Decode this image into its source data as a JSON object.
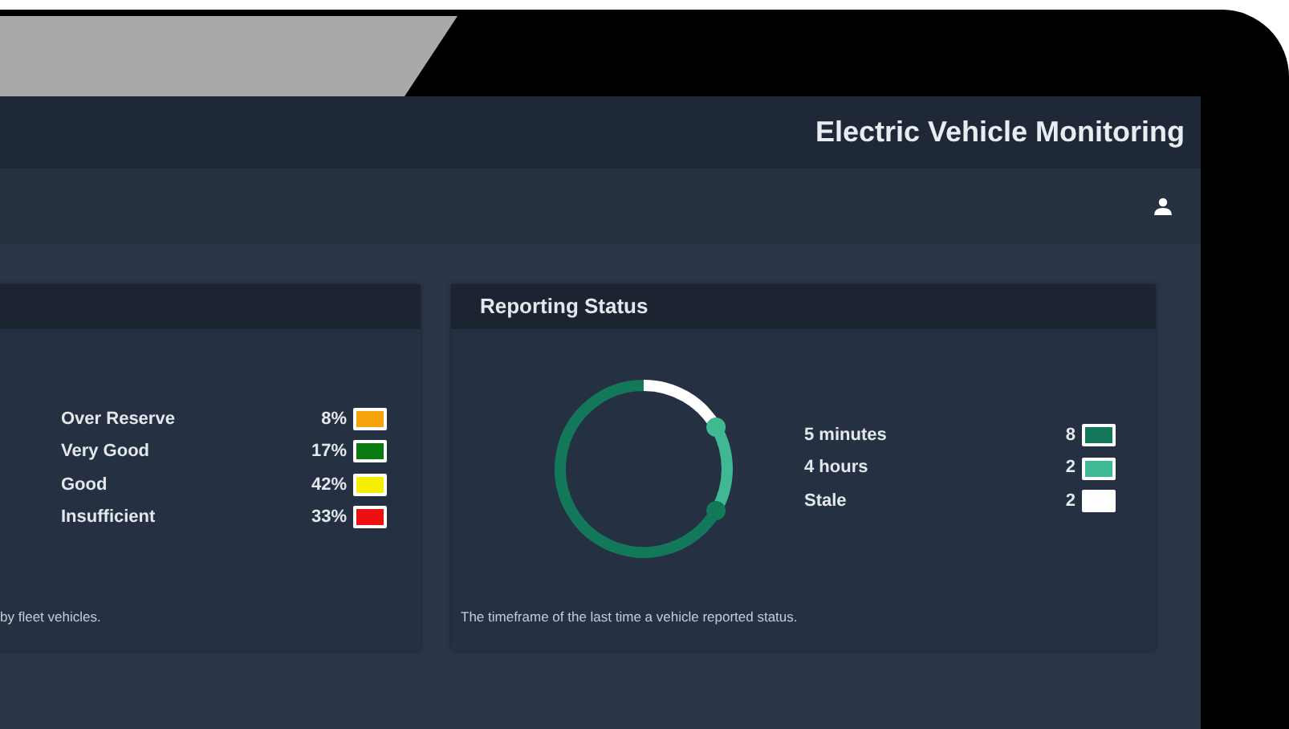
{
  "header": {
    "title": "Electric Vehicle Monitoring"
  },
  "panels": [
    {
      "legend": [
        {
          "label": "Over Reserve",
          "value": "8%",
          "color": "#f5a30a"
        },
        {
          "label": "Very Good",
          "value": "17%",
          "color": "#0a7a10"
        },
        {
          "label": "Good",
          "value": "42%",
          "color": "#f6f000"
        },
        {
          "label": "Insufficient",
          "value": "33%",
          "color": "#ec1010"
        }
      ],
      "description": "by fleet vehicles."
    },
    {
      "title": "Reporting Status",
      "ring": true,
      "legend": [
        {
          "label": "5 minutes",
          "value": "8",
          "color": "#13775a"
        },
        {
          "label": "4 hours",
          "value": "2",
          "color": "#3fb894"
        },
        {
          "label": "Stale",
          "value": "2",
          "color": "#ffffff"
        }
      ],
      "description": "The timeframe of the last time a vehicle reported status."
    }
  ]
}
